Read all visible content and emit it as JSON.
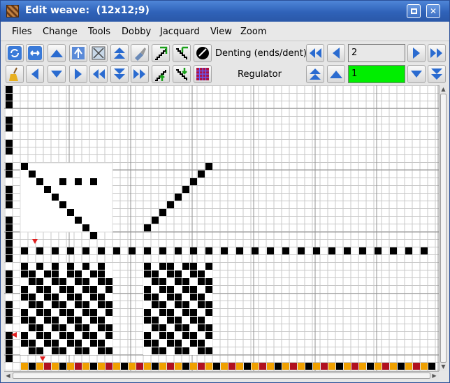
{
  "window": {
    "title": "Edit weave:  (12x12;9)",
    "minimize_glyph": "▫",
    "close_glyph": "✕"
  },
  "menu": [
    {
      "label": "Files"
    },
    {
      "label": "Change"
    },
    {
      "label": "Tools"
    },
    {
      "label": "Dobby"
    },
    {
      "label": "Jacquard"
    },
    {
      "label": "View"
    },
    {
      "label": "Zoom"
    }
  ],
  "toolbar": {
    "denting_label": "Denting (ends/dent)",
    "denting_value": "2",
    "regulator_label": "Regulator",
    "regulator_value": "1",
    "regulator_color": "#00ee00"
  },
  "colors": {
    "titlebar": "#2f62b8",
    "grid_line": "#c8c8c8",
    "grid_major": "#909090",
    "cell_filled": "#000000",
    "marker": "#e02020",
    "color_bar_a": "#f0a000",
    "color_bar_b": "#b01020",
    "color_bar_c": "#000000"
  },
  "icons": [
    "refresh-icon",
    "swap-horizontal-icon",
    "triangle-up-icon",
    "mirror-icon",
    "clear-icon",
    "double-up-icon",
    "brush-icon",
    "twill-in-icon",
    "twill-out-icon",
    "palette-icon",
    "broom-icon",
    "arrow-left-icon",
    "arrow-down-icon",
    "arrow-right-icon",
    "fast-left-icon",
    "double-down-icon",
    "fast-right-icon",
    "diagonal-up-icon",
    "diagonal-down-icon",
    "weave-grid-icon"
  ]
}
